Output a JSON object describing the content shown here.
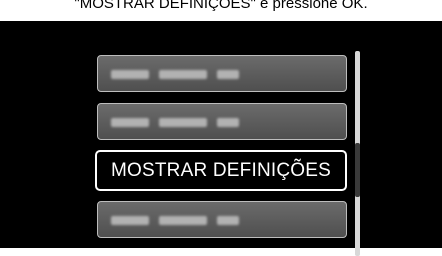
{
  "caption": "\"MOSTRAR DEFINIÇÕES\" e pressione OK.",
  "menu": {
    "items": [
      {
        "label": "",
        "selected": false
      },
      {
        "label": "",
        "selected": false
      },
      {
        "label": "MOSTRAR DEFINIÇÕES",
        "selected": true
      },
      {
        "label": "",
        "selected": false
      }
    ]
  },
  "colors": {
    "background": "#000000",
    "item_fill": "#5a5a5a",
    "item_border": "#bdbdbd",
    "selected_border": "#ffffff",
    "text": "#ffffff"
  }
}
